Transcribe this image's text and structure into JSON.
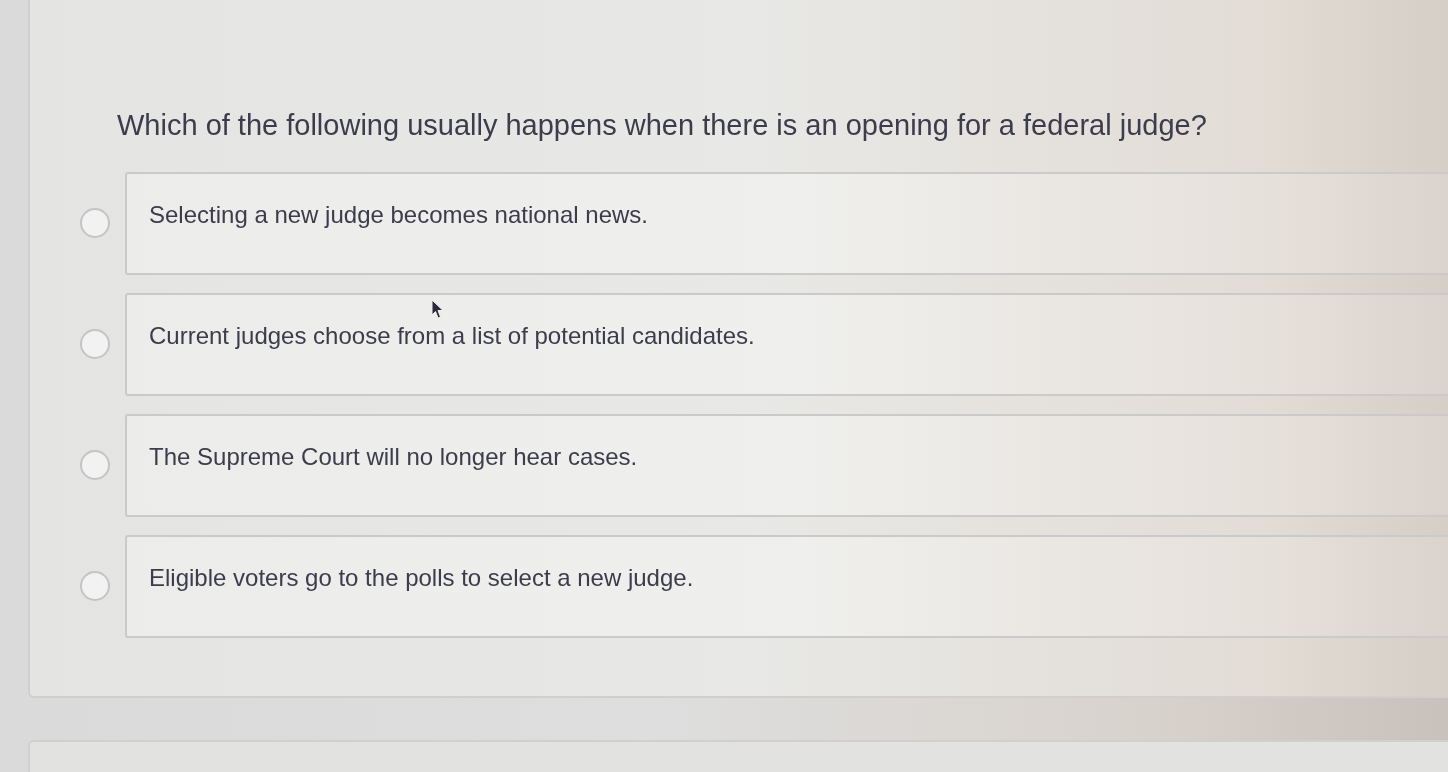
{
  "question": "Which of the following usually happens when there is an opening for a federal judge?",
  "options": [
    {
      "label": "Selecting a new judge becomes national news.",
      "selected": false,
      "hovered": false
    },
    {
      "label": "Current judges choose from a list of potential candidates.",
      "selected": false,
      "hovered": true
    },
    {
      "label": "The Supreme Court will no longer hear cases.",
      "selected": false,
      "hovered": false
    },
    {
      "label": "Eligible voters go to the polls to select a new judge.",
      "selected": false,
      "hovered": false
    }
  ]
}
